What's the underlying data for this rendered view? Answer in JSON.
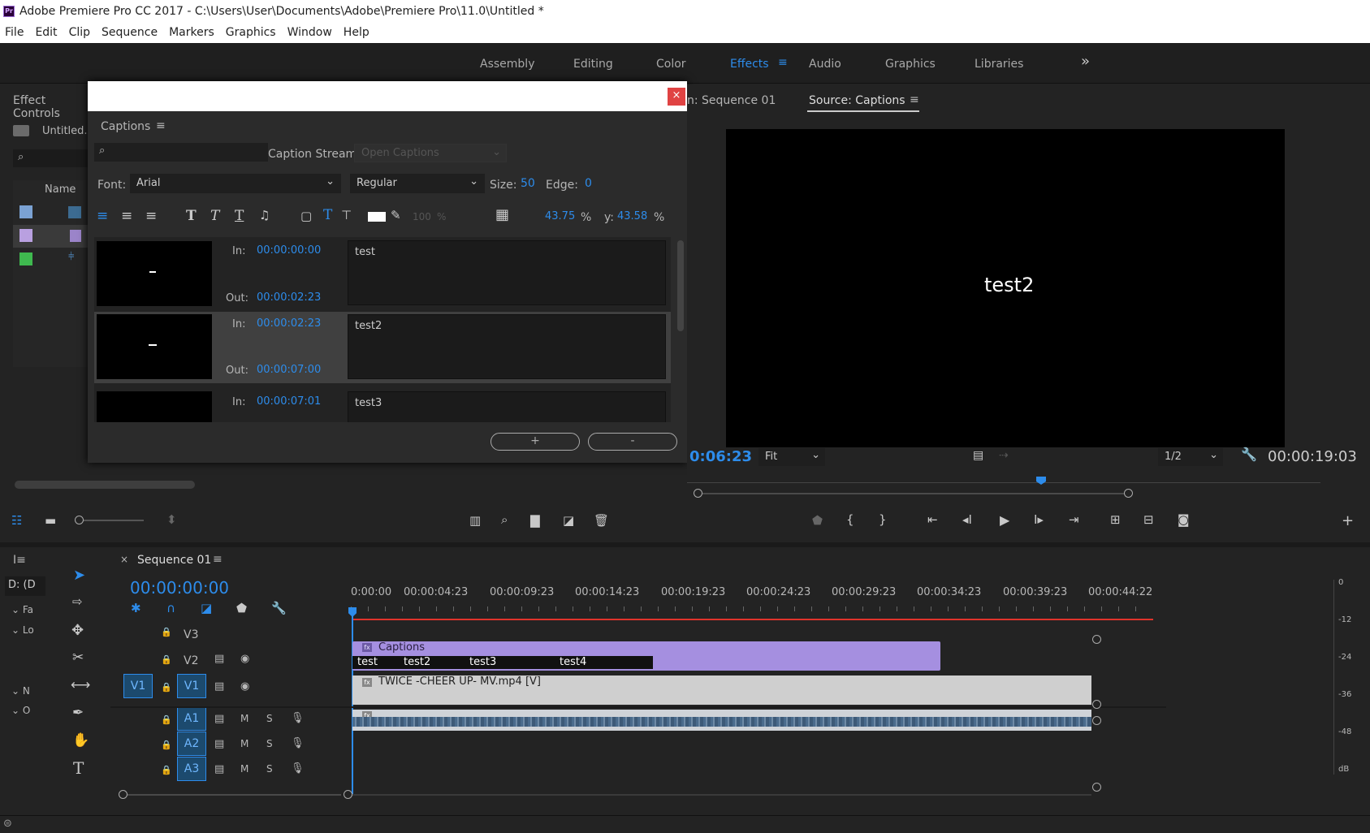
{
  "window": {
    "title": "Adobe Premiere Pro CC 2017 - C:\\Users\\User\\Documents\\Adobe\\Premiere Pro\\11.0\\Untitled *",
    "logo": "Pr"
  },
  "menu": [
    "File",
    "Edit",
    "Clip",
    "Sequence",
    "Markers",
    "Graphics",
    "Window",
    "Help"
  ],
  "workspaces": [
    "Assembly",
    "Editing",
    "Color",
    "Effects",
    "Audio",
    "Graphics",
    "Libraries"
  ],
  "workspaces_active": "Effects",
  "left_panel": {
    "tab": "Effect Controls",
    "project_item": "Untitled.p",
    "name_col": "Name"
  },
  "captions": {
    "panel_title": "Captions",
    "caption_stream_label": "Caption Stream:",
    "caption_stream_value": "Open Captions",
    "font_label": "Font:",
    "font_value": "Arial",
    "style_value": "Regular",
    "size_label": "Size:",
    "size_value": "50",
    "edge_label": "Edge:",
    "edge_value": "0",
    "opacity_value": "100",
    "opacity_unit": "%",
    "x_value": "43.75",
    "x_unit": "%",
    "y_label": "y:",
    "y_value": "43.58",
    "y_unit": "%",
    "in_label": "In:",
    "out_label": "Out:",
    "items": [
      {
        "in": "00:00:00:00",
        "out": "00:00:02:23",
        "text": "test"
      },
      {
        "in": "00:00:02:23",
        "out": "00:00:07:00",
        "text": "test2"
      },
      {
        "in": "00:00:07:01",
        "text": "test3"
      }
    ],
    "add_label": "+",
    "remove_label": "-"
  },
  "program_monitor": {
    "tab_partial": "n: Sequence 01",
    "tab_source": "Source: Captions",
    "caption_text": "test2",
    "timecode": "0:06:23",
    "fit": "Fit",
    "resolution": "1/2",
    "duration": "00:00:19:03"
  },
  "timeline": {
    "sequence_tab": "Sequence 01",
    "timecode": "00:00:00:00",
    "left_track_label": "D: (D",
    "ruler": [
      "0:00:00",
      "00:00:04:23",
      "00:00:09:23",
      "00:00:14:23",
      "00:00:19:23",
      "00:00:24:23",
      "00:00:29:23",
      "00:00:34:23",
      "00:00:39:23",
      "00:00:44:22"
    ],
    "tracks": {
      "video": [
        "V3",
        "V2",
        "V1"
      ],
      "audio": [
        "A1",
        "A2",
        "A3"
      ],
      "source_v1": "V1",
      "mute": "M",
      "solo": "S"
    },
    "caption_clip": "Captions",
    "caption_segments": [
      "test",
      "test2",
      "test3",
      "test4"
    ],
    "video_clip": "TWICE -CHEER UP- MV.mp4 [V]",
    "fx_badge": "fx"
  },
  "meter": {
    "labels": [
      "0",
      "-12",
      "-24",
      "-36",
      "-48",
      "dB"
    ]
  }
}
